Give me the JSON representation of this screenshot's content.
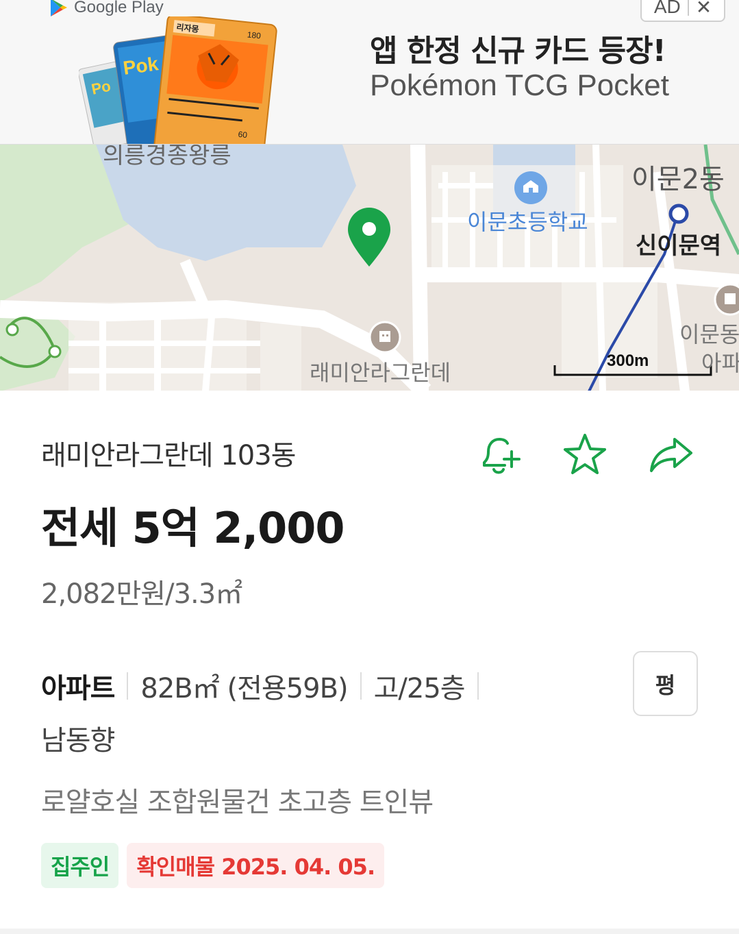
{
  "ad": {
    "store_label": "Google Play",
    "badge": "AD",
    "close_glyph": "✕",
    "title": "앱 한정 신규 카드 등장!",
    "subtitle": "Pokémon TCG Pocket",
    "card_text": "리자몽",
    "card_hp": "180",
    "card_damage": "60"
  },
  "map": {
    "labels": {
      "top_left": "의릉경종왕릉",
      "dong": "이문2동",
      "school": "이문초등학교",
      "station": "신이문역",
      "complex": "래미안라그란데",
      "apt_line1": "이문동",
      "apt_line2": "아파"
    },
    "scale": "300m",
    "colors": {
      "marker": "#1aa34a",
      "subway": "#2b4aa8",
      "green_area": "#cfe7c3",
      "water": "#c9d8ea"
    }
  },
  "listing": {
    "complex_name": "래미안라그란데 103동",
    "price": "전세 5억 2,000",
    "unit_price": "2,082만원/3.3㎡",
    "type": "아파트",
    "area": "82B㎡ (전용59B)",
    "floor": "고/25층",
    "direction": "남동향",
    "description": "로얄호실 조합원물건 초고층 트인뷰",
    "pyeong_button": "평",
    "tags": {
      "owner": "집주인",
      "verified": "확인매물 2025. 04. 05."
    },
    "icons": [
      "bell-plus-icon",
      "star-icon",
      "share-icon"
    ],
    "accent_color": "#1aa34a"
  }
}
